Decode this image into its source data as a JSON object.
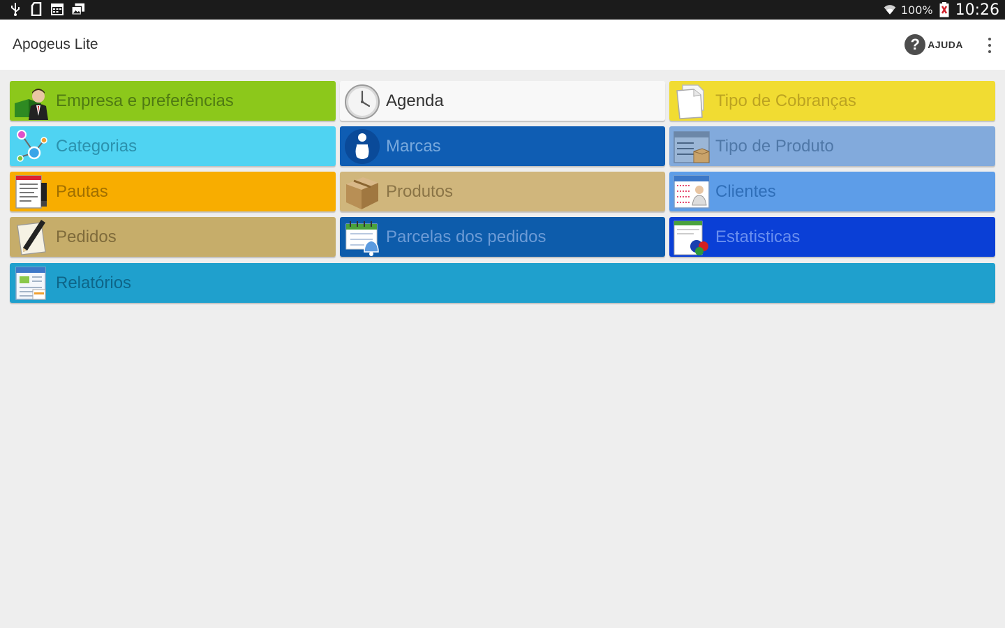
{
  "status_bar": {
    "battery_percent": "100%",
    "time": "10:26",
    "left_icons": [
      "usb-icon",
      "sd-card-icon",
      "calendar-notification-icon",
      "photo-notification-icon"
    ],
    "right_icons": [
      "wifi-icon",
      "battery-low-icon"
    ]
  },
  "action_bar": {
    "title": "Apogeus Lite",
    "help_label": "AJUDA",
    "help_icon": "help-icon",
    "overflow_icon": "overflow-menu-icon"
  },
  "menu": {
    "tiles": [
      {
        "label": "Empresa e preferências",
        "icon": "company-person-icon",
        "bg": "#8cc81b",
        "fg": "#4f7a13"
      },
      {
        "label": "Agenda",
        "icon": "clock-icon",
        "bg": "#f8f8f8",
        "fg": "#333333"
      },
      {
        "label": "Tipo de Cobranças",
        "icon": "documents-icon",
        "bg": "#f1dc32",
        "fg": "#bca321"
      },
      {
        "label": "Categorias",
        "icon": "categories-circles-icon",
        "bg": "#4fd3f2",
        "fg": "#2b91ad"
      },
      {
        "label": "Marcas",
        "icon": "info-icon",
        "bg": "#0f5db3",
        "fg": "#78a9dd"
      },
      {
        "label": "Tipo de Produto",
        "icon": "product-type-icon",
        "bg": "#82aadc",
        "fg": "#4f78a8"
      },
      {
        "label": "Pautas",
        "icon": "document-list-icon",
        "bg": "#f8ad00",
        "fg": "#a06f00"
      },
      {
        "label": "Produtos",
        "icon": "box-icon",
        "bg": "#d0b67c",
        "fg": "#8a7446"
      },
      {
        "label": "Clientes",
        "icon": "client-card-icon",
        "bg": "#5d9de8",
        "fg": "#2f6eb8"
      },
      {
        "label": "Pedidos",
        "icon": "pen-paper-icon",
        "bg": "#c6ad6a",
        "fg": "#7f6b3b"
      },
      {
        "label": "Parcelas dos pedidos",
        "icon": "calendar-bell-icon",
        "bg": "#0d5cab",
        "fg": "#6c9bd6"
      },
      {
        "label": "Estatisticas",
        "icon": "statistics-icon",
        "bg": "#0a3fd6",
        "fg": "#6a8fef"
      },
      {
        "label": "Relatórios",
        "icon": "reports-icon",
        "bg": "#1fa0cd",
        "fg": "#0e6588"
      }
    ]
  }
}
